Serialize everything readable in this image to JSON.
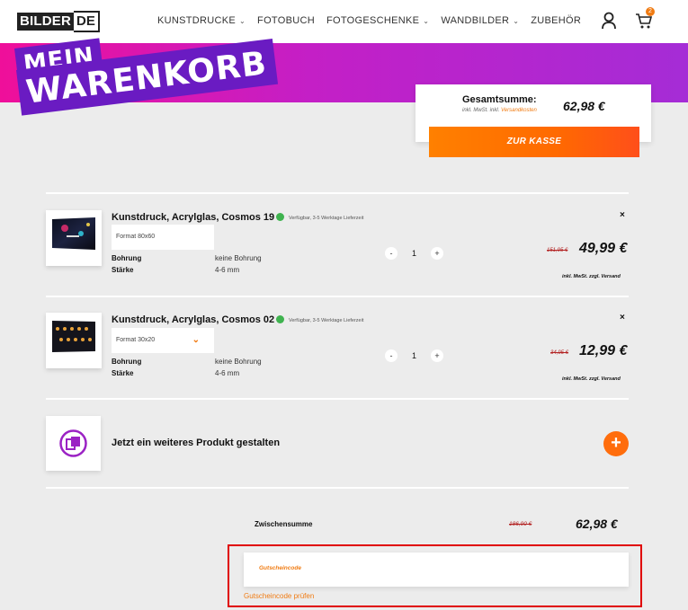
{
  "header": {
    "logo_part1": "BILDER",
    "logo_part2": "DE",
    "nav": [
      {
        "label": "KUNSTDRUCKE",
        "has_dropdown": true
      },
      {
        "label": "FOTOBUCH",
        "has_dropdown": false
      },
      {
        "label": "FOTOGESCHENKE",
        "has_dropdown": true
      },
      {
        "label": "WANDBILDER",
        "has_dropdown": true
      },
      {
        "label": "ZUBEHÖR",
        "has_dropdown": false
      }
    ],
    "cart_count": "2",
    "icons": [
      "user-icon",
      "cart-icon",
      "chevron-down-icon"
    ]
  },
  "hero": {
    "title_line1": "MEIN",
    "title_line2": "WARENKORB",
    "colors": {
      "gradient_start": "#ef0f9a",
      "gradient_end": "#a52cd6",
      "title_bg": "#6a1bc2"
    }
  },
  "summary": {
    "total_label": "Gesamtsumme:",
    "total_sub_prefix": "inkl. MwSt. inkl.",
    "total_sub_link": "Versandkosten",
    "total_value": "62,98 €",
    "checkout_label": "ZUR KASSE",
    "accent": "#ff6a00"
  },
  "items": [
    {
      "title": "Kunstdruck, Acrylglas, Cosmos 19",
      "availability": "Verfügbar, 3-5 Werktage Lieferzeit",
      "format": "Format 80x60",
      "specs": [
        {
          "label": "Bohrung",
          "value": "keine Bohrung"
        },
        {
          "label": "Stärke",
          "value": "4-6 mm"
        }
      ],
      "qty_minus": "-",
      "quantity": "1",
      "qty_plus": "+",
      "old_price": "151,95 €",
      "price": "49,99 €",
      "ship_note": "inkl. MwSt. zzgl. Versand",
      "remove": "×"
    },
    {
      "title": "Kunstdruck, Acrylglas, Cosmos 02",
      "availability": "Verfügbar, 3-5 Werktage Lieferzeit",
      "format": "Format 30x20",
      "specs": [
        {
          "label": "Bohrung",
          "value": "keine Bohrung"
        },
        {
          "label": "Stärke",
          "value": "4-6 mm"
        }
      ],
      "qty_minus": "-",
      "quantity": "1",
      "qty_plus": "+",
      "old_price": "34,95 €",
      "price": "12,99 €",
      "ship_note": "inkl. MwSt. zzgl. Versand",
      "remove": "×"
    }
  ],
  "add_product": {
    "label": "Jetzt ein weiteres Produkt gestalten",
    "button": "+"
  },
  "subtotal": {
    "label": "Zwischensumme",
    "old_value": "186,90 €",
    "value": "62,98 €"
  },
  "voucher": {
    "placeholder": "Gutscheincode",
    "check_link": "Gutscheincode prüfen",
    "highlight_color": "#e00000"
  }
}
